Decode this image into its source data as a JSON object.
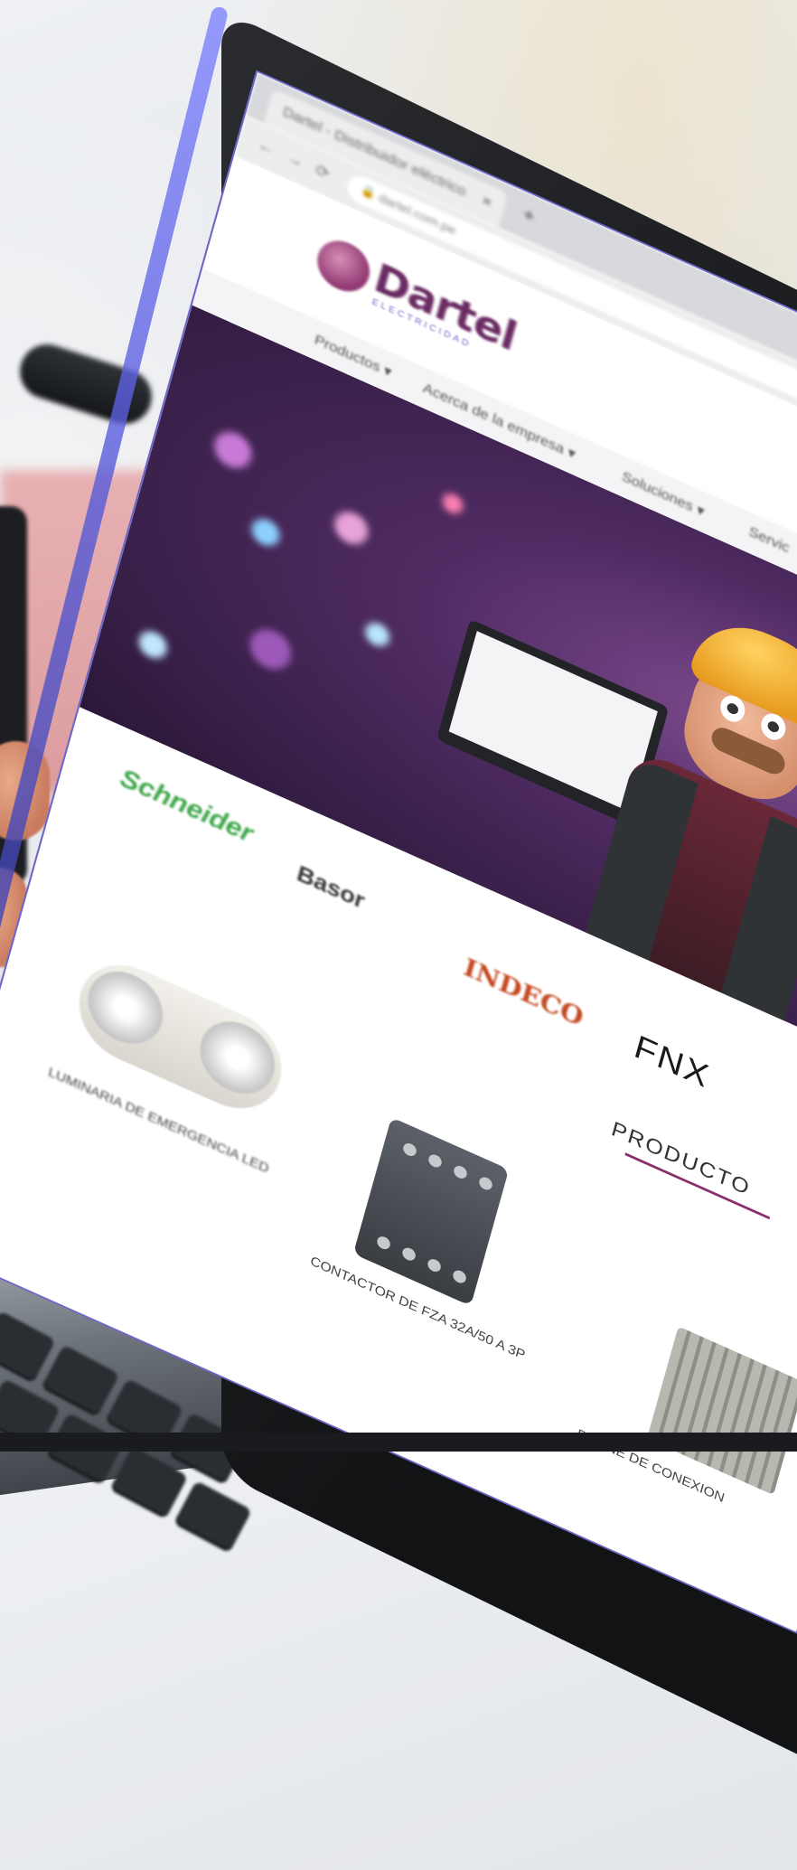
{
  "browser": {
    "tab_title": "Dartel - Distribuidor eléctrico",
    "tab_close": "×",
    "new_tab": "+",
    "back": "←",
    "forward": "→",
    "reload": "⟳",
    "lock": "🔒",
    "url": "dartel.com.pe"
  },
  "site": {
    "logo_text": "Dartel",
    "logo_subtitle": "ELECTRICIDAD",
    "nav": [
      {
        "label": "Productos ▾"
      },
      {
        "label": "Acerca de la empresa ▾"
      },
      {
        "label": "Soluciones ▾"
      },
      {
        "label": "Servic"
      }
    ],
    "brands": {
      "schneider": "Schneider",
      "basor": "Basor",
      "indeco": "INDECO",
      "fnx": "FNX"
    },
    "products": {
      "heading": "PRODUCTO",
      "items": [
        {
          "label": "LUMINARIA DE EMERGENCIA LED"
        },
        {
          "label": "CONTACTOR DE FZA 32A/50 A 3P"
        },
        {
          "label": "BORNE DE CONEXION"
        }
      ]
    }
  },
  "colors": {
    "brand_purple": "#6b2c63",
    "accent_purple": "#8a2f6c",
    "hero_purple": "#4e2a61"
  }
}
